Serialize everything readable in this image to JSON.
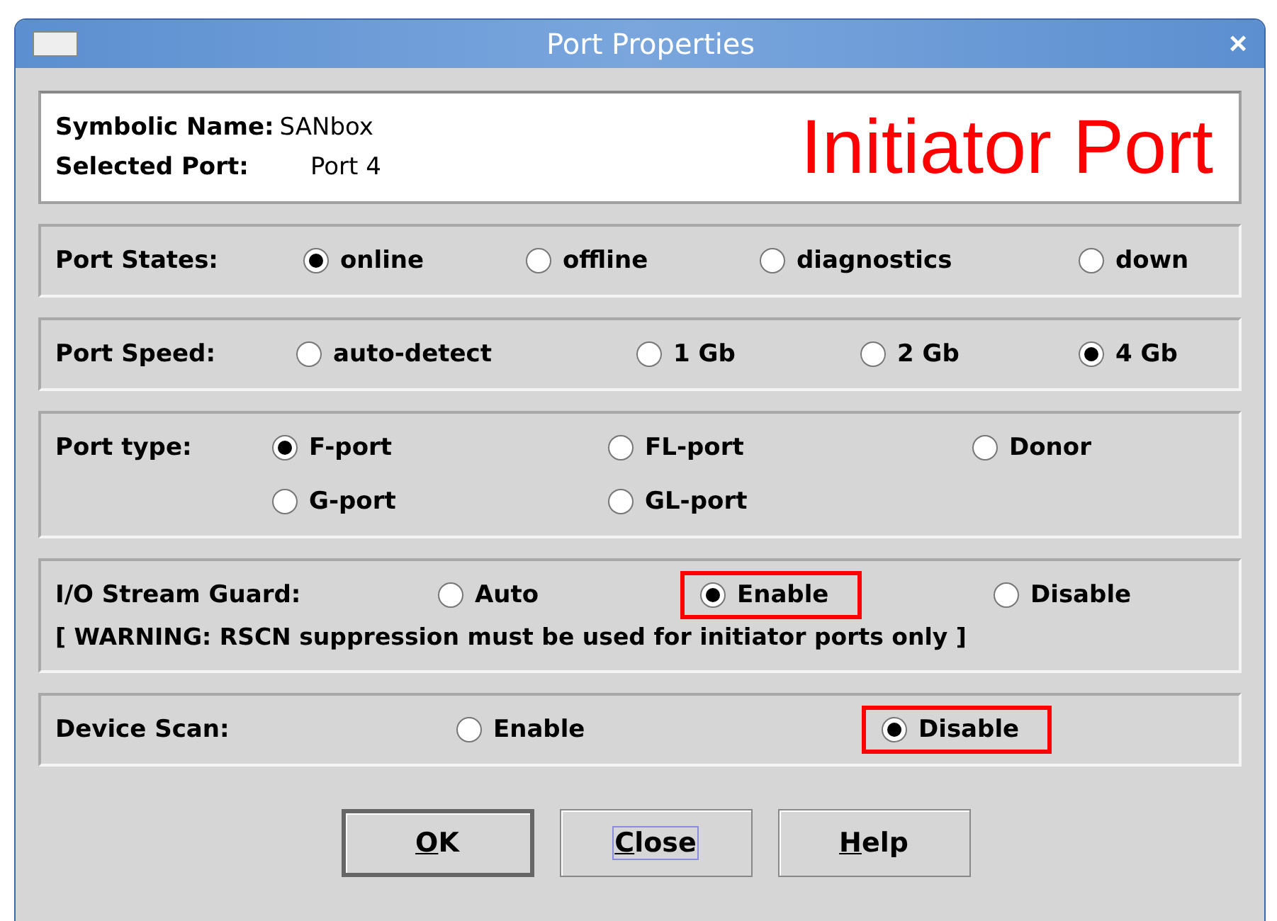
{
  "window": {
    "title": "Port Properties",
    "close": "×"
  },
  "header": {
    "fields": [
      {
        "label": "Symbolic Name:",
        "value": "SANbox"
      },
      {
        "label": "Selected Port:",
        "value": "Port 4"
      }
    ],
    "banner": "Initiator Port"
  },
  "groups": [
    {
      "label": "Port States:",
      "options": [
        {
          "label": "online",
          "selected": true,
          "highlighted": false
        },
        {
          "label": "offline",
          "selected": false,
          "highlighted": false
        },
        {
          "label": "diagnostics",
          "selected": false,
          "highlighted": false
        },
        {
          "label": "down",
          "selected": false,
          "highlighted": false
        }
      ]
    },
    {
      "label": "Port Speed:",
      "options": [
        {
          "label": "auto-detect",
          "selected": false,
          "highlighted": false
        },
        {
          "label": "1 Gb",
          "selected": false,
          "highlighted": false
        },
        {
          "label": "2 Gb",
          "selected": false,
          "highlighted": false
        },
        {
          "label": "4 Gb",
          "selected": true,
          "highlighted": false
        }
      ]
    },
    {
      "label": "Port type:",
      "options": [
        {
          "label": "F-port",
          "selected": true,
          "highlighted": false
        },
        {
          "label": "FL-port",
          "selected": false,
          "highlighted": false
        },
        {
          "label": "Donor",
          "selected": false,
          "highlighted": false
        },
        {
          "label": "G-port",
          "selected": false,
          "highlighted": false
        },
        {
          "label": "GL-port",
          "selected": false,
          "highlighted": false
        }
      ]
    },
    {
      "label": "I/O Stream Guard:",
      "options": [
        {
          "label": "Auto",
          "selected": false,
          "highlighted": false
        },
        {
          "label": "Enable",
          "selected": true,
          "highlighted": true
        },
        {
          "label": "Disable",
          "selected": false,
          "highlighted": false
        }
      ],
      "warning": "[ WARNING: RSCN suppression must be used for initiator ports only ]"
    },
    {
      "label": "Device Scan:",
      "options": [
        {
          "label": "Enable",
          "selected": false,
          "highlighted": false
        },
        {
          "label": "Disable",
          "selected": true,
          "highlighted": true
        }
      ]
    }
  ],
  "buttons": [
    {
      "label": "OK",
      "focused": false,
      "default": true
    },
    {
      "label": "Close",
      "focused": true,
      "default": false
    },
    {
      "label": "Help",
      "focused": false,
      "default": false
    }
  ]
}
